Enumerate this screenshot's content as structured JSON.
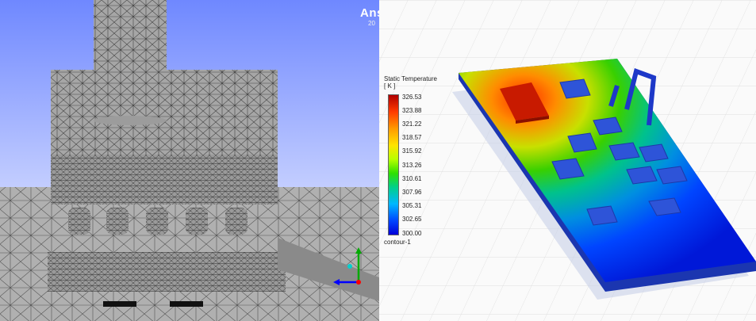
{
  "viewer": {
    "brand_label": "Ans",
    "brand_sub_label": "20"
  },
  "legend": {
    "title": "Static Temperature",
    "unit": "[ K ]",
    "ticks": [
      "326.53",
      "323.88",
      "321.22",
      "318.57",
      "315.92",
      "313.26",
      "310.61",
      "307.96",
      "305.31",
      "302.65",
      "300.00"
    ],
    "contour_name": "contour-1"
  },
  "colors": {
    "background_left_top": "#6f88ff",
    "background_left_bottom": "#ffffff",
    "mesh_surface": "#a6a6a6",
    "hot": "#b00000",
    "cold": "#0000d8",
    "axis_x": "#ff0000",
    "axis_y": "#00aa00",
    "axis_z": "#0000ff"
  }
}
